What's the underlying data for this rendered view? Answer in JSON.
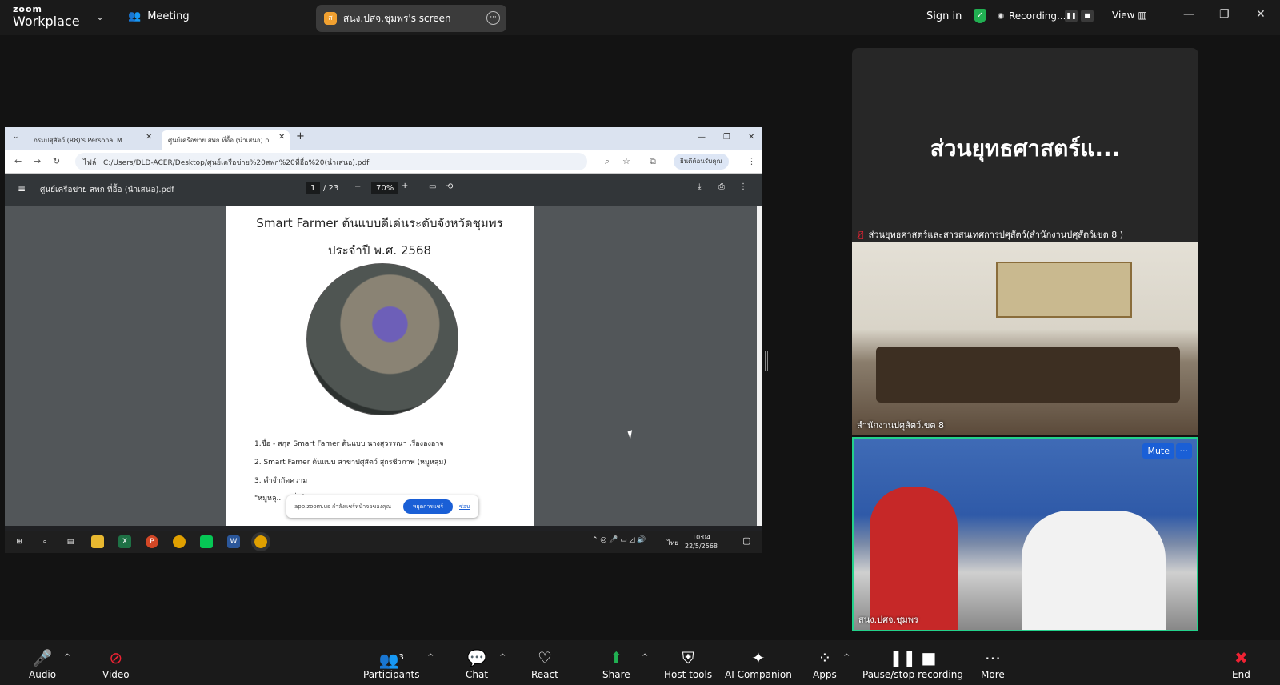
{
  "topbar": {
    "logo_top": "zoom",
    "logo_bottom": "Workplace",
    "meeting_label": "Meeting",
    "share_pill_label": "สนง.ปสจ.ชุมพร's screen",
    "share_pill_initial": "ส",
    "signin": "Sign in",
    "recording": "Recording...",
    "view": "View"
  },
  "browser": {
    "tab1": "กรมปศุสัตว์ (R8)'s Personal M",
    "tab2": "ศูนย์เครือข่าย สพก ที่อื้อ (นำเสนอ).p",
    "url_prefix": "ไฟล์",
    "url": "C:/Users/DLD-ACER/Desktop/ศูนย์เครือข่าย%20สพก%20ที่อื้อ%20(นำเสนอ).pdf",
    "profile": "ยินดีต้อนรับคุณ"
  },
  "pdf": {
    "filename": "ศูนย์เครือข่าย สพก ที่อื้อ (นำเสนอ).pdf",
    "page_current": "1",
    "page_total": "/ 23",
    "zoom": "70%",
    "title1": "Smart Farmer ต้นแบบดีเด่นระดับจังหวัดชุมพร",
    "title2": "ประจำปี พ.ศ. 2568",
    "line1": "1.ชื่อ - สกุล Smart Famer ต้นแบบ    นางสุวรรณา เรืององอาจ",
    "line2": "2. Smart Famer ต้นแบบ  สาขาปศุสัตว์ สุกรชีวภาพ (หมูหลุม)",
    "line3": "3. คำจำกัดความ",
    "line4": "\"หมูหลุ...                                    ...ยั่งยืน\"",
    "zoom_notice": "app.zoom.us กำลังแชร์หน้าจอของคุณ",
    "zoom_stop": "หยุดการแชร์",
    "zoom_hide": "ซ่อน"
  },
  "taskbar": {
    "time": "10:04",
    "date": "22/5/2568",
    "lang": "ไทย"
  },
  "tiles": [
    {
      "big": "ส่วนยุทธศาสตร์แ...",
      "name": "ส่วนยุทธศาสตร์และสารสนเทศการปศุสัตว์(สำนักงานปศุสัตว์เขต 8 )"
    },
    {
      "name": "สำนักงานปศุสัตว์เขต 8"
    },
    {
      "name": "สนง.ปศจ.ชุมพร",
      "mute": "Mute",
      "more": "···"
    }
  ],
  "toolbar": {
    "audio": "Audio",
    "video": "Video",
    "participants": "Participants",
    "participants_count": "3",
    "chat": "Chat",
    "react": "React",
    "share": "Share",
    "host_tools": "Host tools",
    "ai_companion": "AI Companion",
    "apps": "Apps",
    "pause_recording": "Pause/stop recording",
    "more": "More",
    "end": "End"
  }
}
